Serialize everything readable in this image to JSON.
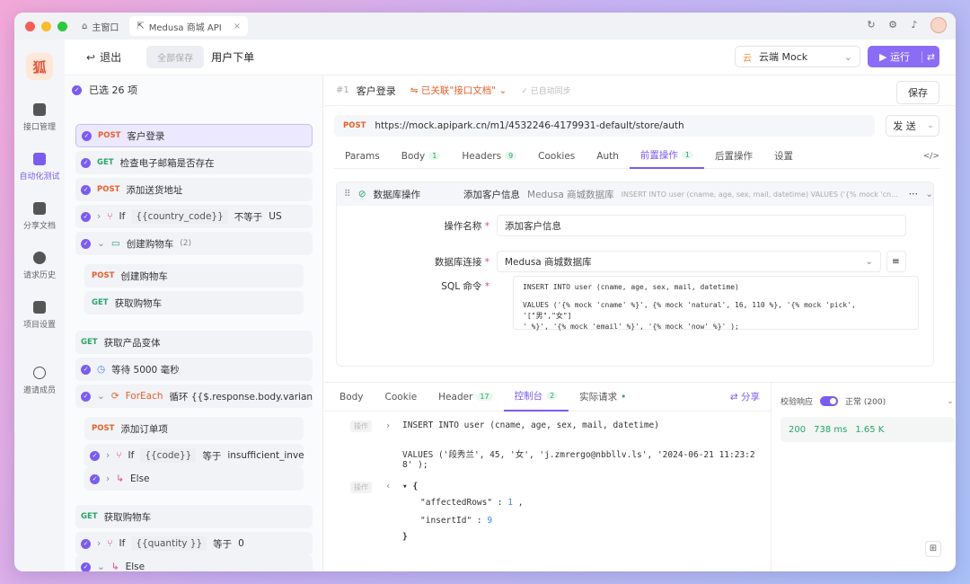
{
  "window": {
    "tabs": [
      {
        "label": "主窗口",
        "icon": "home-icon"
      },
      {
        "label": "Medusa 商城 API",
        "icon": "share-icon"
      }
    ]
  },
  "sidebar": {
    "items": [
      {
        "label": "接口管理",
        "icon": "api-icon"
      },
      {
        "label": "自动化测试",
        "icon": "automation-icon",
        "active": true
      },
      {
        "label": "分享文档",
        "icon": "document-icon"
      },
      {
        "label": "请求历史",
        "icon": "history-icon"
      },
      {
        "label": "项目设置",
        "icon": "settings-icon"
      },
      {
        "label": "邀请成员",
        "icon": "invite-icon"
      }
    ]
  },
  "toolbar": {
    "back_label": "退出",
    "save_all_label": "全部保存",
    "title": "用户下单",
    "env_prefix": "云",
    "env_label": "云端 Mock",
    "run_label": "运行"
  },
  "steps": {
    "selected_count": "已选 26 项",
    "items": [
      {
        "method": "POST",
        "label": "客户登录"
      },
      {
        "method": "GET",
        "label": "检查电子邮箱是否存在"
      },
      {
        "method": "POST",
        "label": "添加送货地址"
      },
      {
        "type": "if",
        "label": "If",
        "var": "{{country_code}}",
        "op": "不等于",
        "value": "US"
      },
      {
        "type": "group",
        "label": "创建购物车",
        "count": "(2)"
      },
      {
        "method": "POST",
        "label": "创建购物车"
      },
      {
        "method": "GET",
        "label": "获取购物车"
      },
      {
        "method": "GET",
        "label": "获取产品变体"
      },
      {
        "type": "wait",
        "label": "等待 5000 毫秒"
      },
      {
        "type": "foreach",
        "label": "ForEach",
        "desc": "循环 {{$.response.body.variants[*]."
      },
      {
        "method": "POST",
        "label": "添加订单项"
      },
      {
        "type": "if",
        "label": "If",
        "var": "{{code}}",
        "op": "等于",
        "value": "insufficient_inventory"
      },
      {
        "type": "else",
        "label": "Else"
      },
      {
        "method": "GET",
        "label": "获取购物车"
      },
      {
        "type": "if",
        "label": "If",
        "var": "{{quantity }}",
        "op": "等于",
        "value": "0"
      },
      {
        "type": "else",
        "label": "Else"
      }
    ]
  },
  "request": {
    "index": "#1",
    "name": "客户登录",
    "linked": "已关联\"接口文档\"",
    "auto_sync": "已自动同步",
    "save_label": "保存",
    "method": "POST",
    "url": "https://mock.apipark.cn/m1/4532246-4179931-default/store/auth",
    "send_label": "发 送",
    "tabs": [
      {
        "label": "Params"
      },
      {
        "label": "Body",
        "badge": "1"
      },
      {
        "label": "Headers",
        "badge": "9"
      },
      {
        "label": "Cookies"
      },
      {
        "label": "Auth"
      },
      {
        "label": "前置操作",
        "badge": "1",
        "active": true
      },
      {
        "label": "后置操作"
      },
      {
        "label": "设置"
      }
    ],
    "code_toggle": "</>"
  },
  "db_op": {
    "title": "数据库操作",
    "name": "添加客户信息",
    "db": "Medusa 商城数据库",
    "sql_preview": "INSERT INTO user (cname, age, sex, mail, datetime) VALUES ('{% mock 'cname' %}', (...",
    "field_name_label": "操作名称",
    "field_name_value": "添加客户信息",
    "field_db_label": "数据库连接",
    "field_db_value": "Medusa 商城数据库",
    "field_sql_label": "SQL 命令",
    "sql_line1": "INSERT INTO user (cname, age, sex, mail, datetime)",
    "sql_line2": "VALUES ('{% mock 'cname' %}', {% mock 'natural', 16, 110 %}, '{% mock 'pick', '[\"男\",\"女\"]",
    "sql_line3": "' %}', '{% mock 'email' %}', '{% mock 'now' %}' );"
  },
  "response": {
    "tabs": [
      {
        "label": "Body"
      },
      {
        "label": "Cookie"
      },
      {
        "label": "Header",
        "badge": "17"
      },
      {
        "label": "控制台",
        "badge": "2",
        "active": true
      },
      {
        "label": "实际请求"
      }
    ],
    "share_label": "分享",
    "log_tag": "操作",
    "log_line1": "INSERT INTO user (cname, age, sex, mail, datetime)",
    "log_line2": "VALUES ('段秀兰', 45, '女', 'j.zmrergo@nbbllv.ls', '2024-06-21 11:23:2",
    "log_line3": "8' );",
    "json_open": "{",
    "json_key1": "\"affectedRows\"",
    "json_val1": "1",
    "json_key2": "\"insertId\"",
    "json_val2": "9",
    "json_close": "}"
  },
  "inspector": {
    "validate_label": "校验响应",
    "status_label": "正常 (200)",
    "code": "200",
    "time": "738 ms",
    "size": "1.65 K"
  },
  "colors": {
    "accent": "#7c5cf0",
    "post": "#e8602c",
    "get": "#27a569"
  }
}
